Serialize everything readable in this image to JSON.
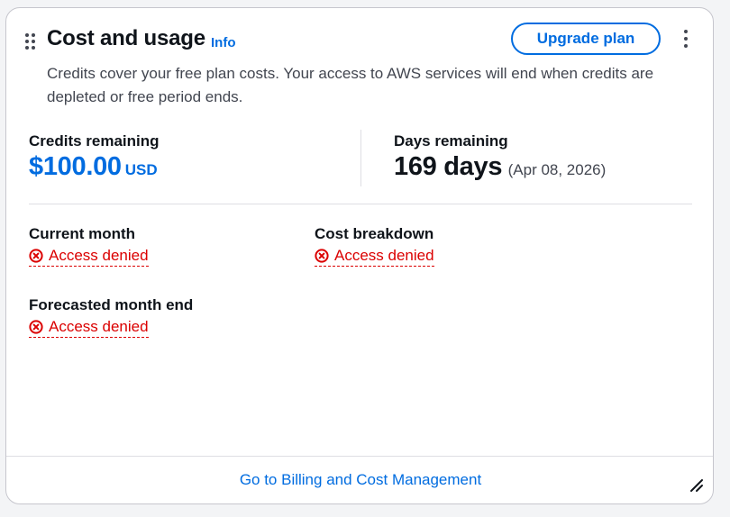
{
  "card": {
    "title": "Cost and usage",
    "info_label": "Info",
    "upgrade_label": "Upgrade plan",
    "description": "Credits cover your free plan costs. Your access to AWS services will end when credits are depleted or free period ends."
  },
  "credits": {
    "label": "Credits remaining",
    "amount": "$100.00",
    "currency": "USD"
  },
  "days": {
    "label": "Days remaining",
    "value": "169 days",
    "date": "(Apr 08, 2026)"
  },
  "metrics": {
    "current_month": {
      "label": "Current month",
      "status": "Access denied"
    },
    "cost_breakdown": {
      "label": "Cost breakdown",
      "status": "Access denied"
    },
    "forecasted": {
      "label": "Forecasted month end",
      "status": "Access denied"
    }
  },
  "footer": {
    "link": "Go to Billing and Cost Management"
  },
  "colors": {
    "accent": "#006ce0",
    "error": "#db0000",
    "text": "#0f141a",
    "muted": "#424650"
  },
  "icons": {
    "drag": "drag-handle-icon",
    "menu": "more-vertical-icon",
    "error": "error-circle-icon",
    "resize": "resize-handle-icon"
  }
}
